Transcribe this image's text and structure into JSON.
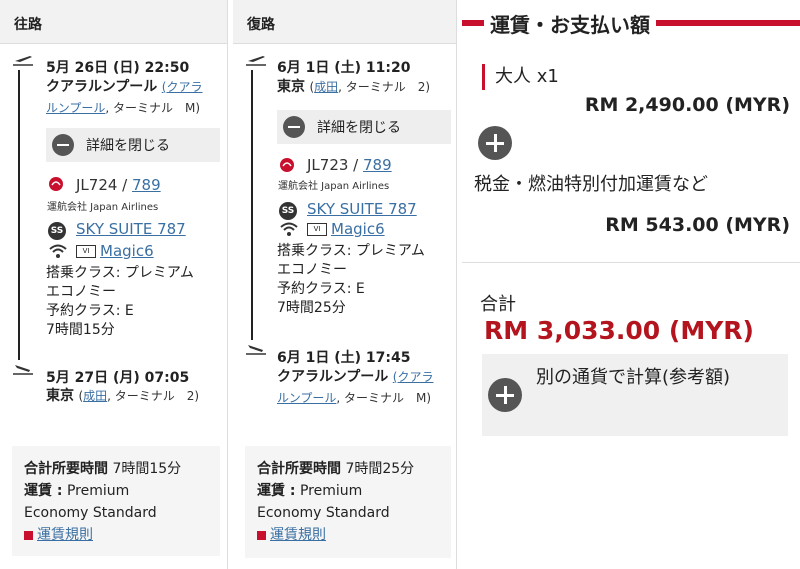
{
  "outbound": {
    "header": "往路",
    "departure": {
      "datetime": "5月 26日 (日) 22:50",
      "city": "クアラルンプール",
      "airport_link_1": "(クアラ",
      "airport_link_2": "ルンプール",
      "terminal": ", ターミナル　M)"
    },
    "detail_button": "詳細を閉じる",
    "flight": {
      "prefix": "JL724 / ",
      "number": "789",
      "operated_by": "運航会社 Japan Airlines"
    },
    "seat": "SKY SUITE 787",
    "entertainment": "Magic6",
    "class_line_1": "搭乗クラス: プレミアム",
    "class_line_2": "エコノミー",
    "booking_class": "予約クラス: E",
    "duration": "7時間15分",
    "arrival": {
      "datetime": "5月 27日 (月) 07:05",
      "city": "東京",
      "airport_link": "成田",
      "terminal_pre": "(",
      "terminal": ", ターミナル　2)"
    },
    "summary": {
      "total_time_label": "合計所要時間",
      "total_time": "7時間15分",
      "fare_label": "運賃 :",
      "fare_value_1": "Premium",
      "fare_value_2": "Economy Standard",
      "rules_link": "運賃規則"
    }
  },
  "return": {
    "header": "復路",
    "departure": {
      "datetime": "6月 1日 (土) 11:20",
      "city": "東京",
      "airport_link": "成田",
      "terminal_pre": "(",
      "terminal": ", ターミナル　2)"
    },
    "detail_button": "詳細を閉じる",
    "flight": {
      "prefix": "JL723 / ",
      "number": "789",
      "operated_by": "運航会社 Japan Airlines"
    },
    "seat": "SKY SUITE 787",
    "entertainment": "Magic6",
    "class_line_1": "搭乗クラス: プレミアム",
    "class_line_2": "エコノミー",
    "booking_class": "予約クラス: E",
    "duration": "7時間25分",
    "arrival": {
      "datetime": "6月 1日 (土) 17:45",
      "city": "クアラルンプール",
      "airport_link_1": "(クアラ",
      "airport_link_2": "ルンプール",
      "terminal": ", ターミナル　M)"
    },
    "summary": {
      "total_time_label": "合計所要時間",
      "total_time": "7時間25分",
      "fare_label": "運賃 :",
      "fare_value_1": "Premium",
      "fare_value_2": "Economy Standard",
      "rules_link": "運賃規則"
    }
  },
  "fare": {
    "title": "運賃・お支払い額",
    "adult_label": "大人 x1",
    "adult_amount": "RM 2,490.00 (MYR)",
    "tax_label": "税金・燃油特別付加運賃など",
    "tax_amount": "RM 543.00 (MYR)",
    "total_label": "合計",
    "total_amount": "RM 3,033.00 (MYR)",
    "convert_label": "別の通貨で計算(参考額)"
  },
  "colors": {
    "accent": "#c8102e",
    "link": "#3a6fa3",
    "total": "#b3141e"
  },
  "icons": [
    "takeoff-icon",
    "landing-icon",
    "minus-circle-icon",
    "jal-crane-icon",
    "ss-badge-icon",
    "wifi-icon",
    "tv-icon",
    "plus-circle-icon",
    "rule-icon"
  ]
}
